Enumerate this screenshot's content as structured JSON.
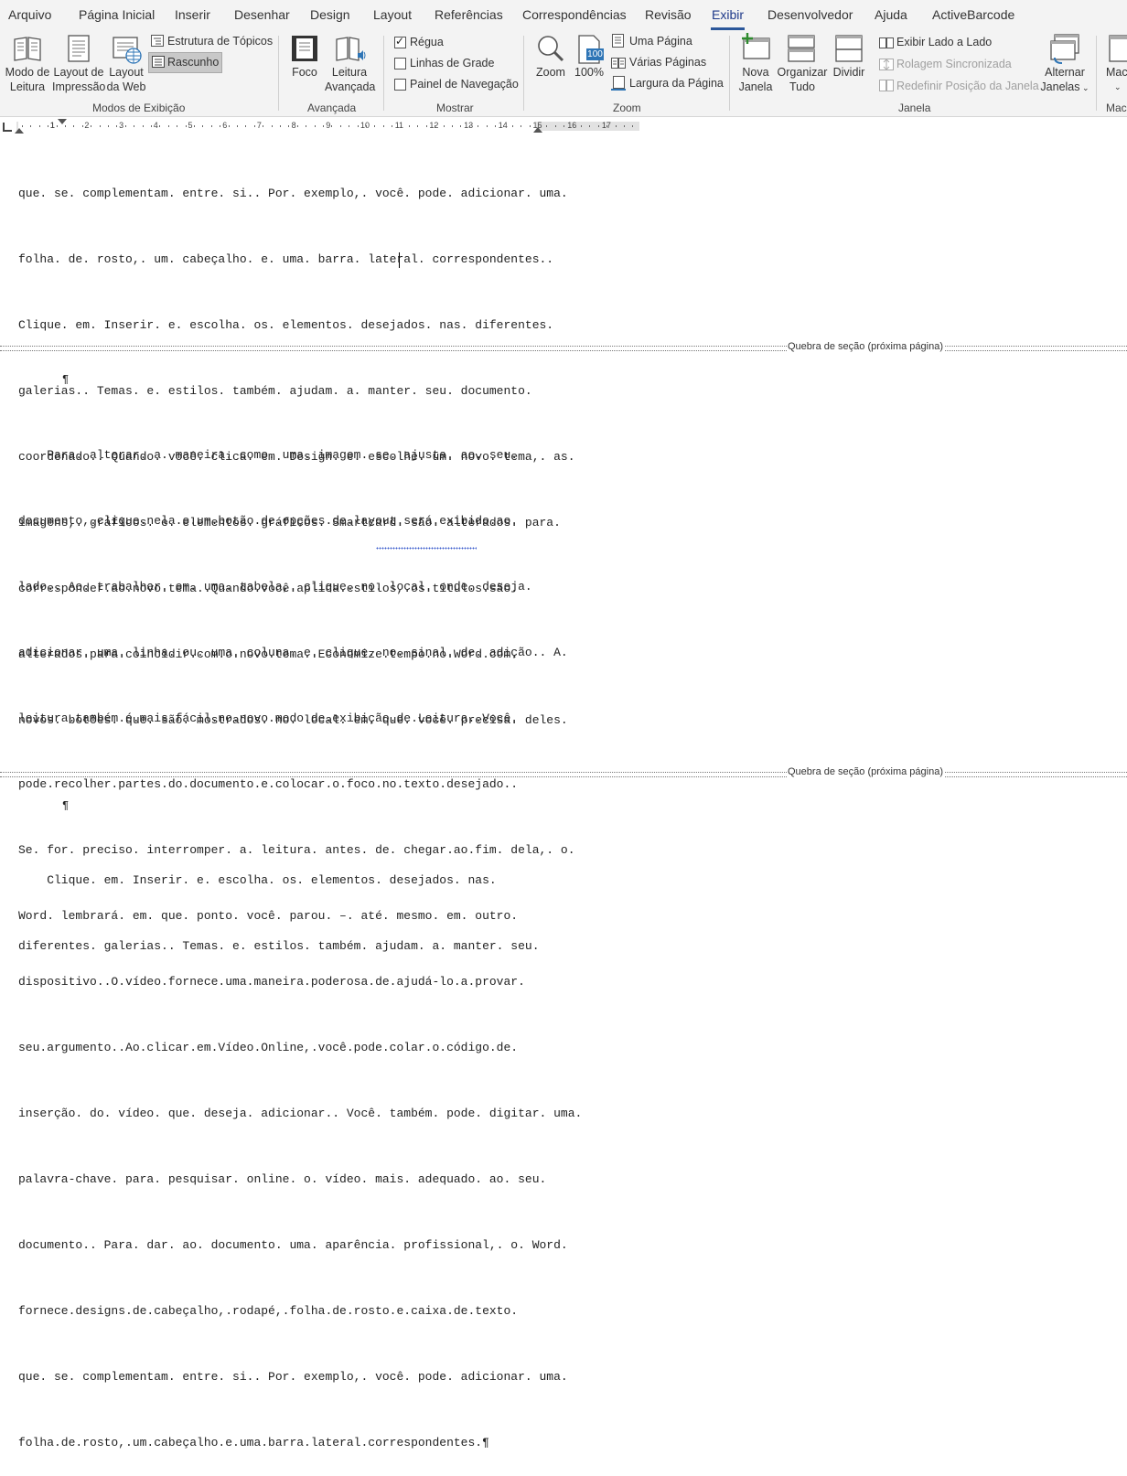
{
  "tabs": [
    "Arquivo",
    "Página Inicial",
    "Inserir",
    "Desenhar",
    "Design",
    "Layout",
    "Referências",
    "Correspondências",
    "Revisão",
    "Exibir",
    "Desenvolvedor",
    "Ajuda",
    "ActiveBarcode"
  ],
  "ribbon": {
    "views": {
      "leitura_1": "Modo de",
      "leitura_2": "Leitura",
      "impressao_1": "Layout de",
      "impressao_2": "Impressão",
      "web_1": "Layout",
      "web_2": "da Web",
      "topicos": "Estrutura de Tópicos",
      "rascunho": "Rascunho",
      "group": "Modos de Exibição"
    },
    "immersive": {
      "foco": "Foco",
      "leitura_1": "Leitura",
      "leitura_2": "Avançada",
      "group": "Avançada"
    },
    "show": {
      "regua": "Régua",
      "grade": "Linhas de Grade",
      "navegacao": "Painel de Navegação",
      "group": "Mostrar",
      "regua_checked": true,
      "grade_checked": false,
      "navegacao_checked": false
    },
    "zoom": {
      "zoom": "Zoom",
      "cem": "100%",
      "cem_badge": "100",
      "uma": "Uma Página",
      "varias": "Várias Páginas",
      "largura": "Largura da Página",
      "group": "Zoom"
    },
    "window": {
      "nova_1": "Nova",
      "nova_2": "Janela",
      "organizar_1": "Organizar",
      "organizar_2": "Tudo",
      "dividir": "Dividir",
      "lado": "Exibir Lado a Lado",
      "rolagem": "Rolagem Sincronizada",
      "redefinir": "Redefinir Posição da Janela",
      "alternar_1": "Alternar",
      "alternar_2": "Janelas",
      "group": "Janela"
    },
    "macros": {
      "label": "Mac",
      "group": "Mac"
    }
  },
  "ruler": {
    "numbers": [
      "1",
      "1",
      "2",
      "3",
      "4",
      "5",
      "6",
      "7",
      "8",
      "9",
      "10",
      "11",
      "12",
      "13",
      "14",
      "15",
      "16",
      "17"
    ]
  },
  "document": {
    "block1": [
      "que. se. complementam. entre. si.. Por. exemplo,. você. pode. adicionar. uma.",
      "folha. de. rosto,. um. cabeçalho. e. uma. barra. lateral. correspondentes..",
      "Clique. em. Inserir. e. escolha. os. elementos. desejados. nas. diferentes.",
      "galerias.. Temas. e. estilos. também. ajudam. a. manter. seu. documento.",
      "coordenado.. Quando. você. clica. em. Design. e. escolhe. um. novo. tema,. as.",
      "imagens,. gráficos. e. elementos. gráficos. Smartcard. são. alterados. para.",
      "corresponder.ao.novo.tema..Quando.você.aplica.estilos,.os.títulos.são.",
      "alterados.para.coincidir.com.o.novo.tema..Economize.tempo.no.Word.com.",
      "novos. botões. que. são. mostrados. no. local. em. que. você. precisa. deles."
    ],
    "section_break": "Quebra de seção (próxima página)",
    "pilcrow": "¶",
    "block2": [
      "    Para. alterar. a. maneira. como. uma. imagem. se. ajusta. ao. seu.",
      "documento,.clique.nela.e.um.botão.de.opções.de.layout.será.exibido.ao.",
      "lado.. Ao. trabalhar. em. uma. tabela,. clique. no. local. onde. deseja.",
      "adicionar. uma. linha. ou. uma. coluna. e. clique. no. sinal. de. adição.. A.",
      "leitura.também.é.mais.fácil.no.novo.modo.de.exibição.de.Leitura..Você.",
      "pode.recolher.partes.do.documento.e.colocar.o.foco.no.texto.desejado..",
      "Se. for. preciso. interromper. a. leitura. antes. de. chegar.ao.fim. dela,. o.",
      "Word. lembrará. em. que. ponto. você. parou. –. até. mesmo. em. outro.",
      "dispositivo..O.vídeo.fornece.uma.maneira.poderosa.de.ajudá-lo.a.provar.",
      "seu.argumento..Ao.clicar.em.Vídeo.Online,.você.pode.colar.o.código.de.",
      "inserção. do. vídeo. que. deseja. adicionar.. Você. também. pode. digitar. uma.",
      "palavra-chave. para. pesquisar. online. o. vídeo. mais. adequado. ao. seu.",
      "documento.. Para. dar. ao. documento. uma. aparência. profissional,. o. Word.",
      "fornece.designs.de.cabeçalho,.rodapé,.folha.de.rosto.e.caixa.de.texto.",
      "que. se. complementam. entre. si.. Por. exemplo,. você. pode. adicionar. uma.",
      "folha.de.rosto,.um.cabeçalho.e.uma.barra.lateral.correspondentes.¶"
    ],
    "block3": [
      "    Clique. em. Inserir. e. escolha. os. elementos. desejados. nas.",
      "diferentes. galerias.. Temas. e. estilos. também. ajudam. a. manter. seu."
    ]
  }
}
